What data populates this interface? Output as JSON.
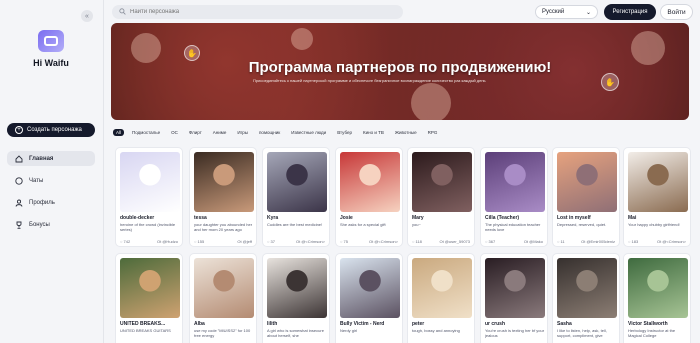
{
  "app": {
    "name": "Hi Waifu"
  },
  "search": {
    "placeholder": "Найти персонажа"
  },
  "language": {
    "selected": "Русский"
  },
  "header": {
    "register": "Регистрация",
    "login": "Войти"
  },
  "sidebar": {
    "create": "Создать персонажа",
    "items": [
      {
        "label": "Главная",
        "icon": "home-icon"
      },
      {
        "label": "Чаты",
        "icon": "chat-icon"
      },
      {
        "label": "Профиль",
        "icon": "user-icon"
      },
      {
        "label": "Бонусы",
        "icon": "trophy-icon"
      }
    ]
  },
  "banner": {
    "title": "Программа партнеров по продвижению!",
    "subtitle": "Присоединяйтесь к нашей партнерской программе и обеспечьте безграничное вознаграждение количество раз каждый день"
  },
  "tags": [
    "All",
    "Подмосталье",
    "OC",
    "Флирт",
    "Аниме",
    "Игры",
    "помощник",
    "Известные люди",
    "Втубер",
    "Кино и ТВ",
    "Животные",
    "RPG"
  ],
  "cards": [
    {
      "name": "double-decker",
      "desc": "heroine of the crowd (invincible series)",
      "count": "742",
      "author": "Ot @Hudzo",
      "colors": [
        "#d8d6f2",
        "#ffffff"
      ]
    },
    {
      "name": "tessa",
      "desc": "your daughter you abounded her and her mom 20 years ago",
      "count": "155",
      "author": "Ot @jeff",
      "colors": [
        "#3a2b22",
        "#c99a7a"
      ]
    },
    {
      "name": "Kyra",
      "desc": "Cuddles are the best medicine!",
      "count": "37",
      "author": "Ot @<Crimson>",
      "colors": [
        "#a5a7b8",
        "#3b3448"
      ]
    },
    {
      "name": "Josie",
      "desc": "She asks for a special gift",
      "count": "75",
      "author": "Ot @<Crimson>",
      "colors": [
        "#c73838",
        "#f6d2c0"
      ]
    },
    {
      "name": "Mary",
      "desc": "you~",
      "count": "118",
      "author": "Ot @user_59073",
      "colors": [
        "#2c1a1c",
        "#806060"
      ]
    },
    {
      "name": "Cilla (Teacher)",
      "desc": "The physical education teacher needs love",
      "count": "367",
      "author": "Ot @Mako",
      "colors": [
        "#5c3f79",
        "#a98cc6"
      ]
    },
    {
      "name": "Lost in myself",
      "desc": "Depressed, reserved, quiet.",
      "count": "11",
      "author": "Ot @Emir005deniz",
      "colors": [
        "#e6a27e",
        "#8f6f76"
      ]
    },
    {
      "name": "Mai",
      "desc": "Your happy chubby girlfriend!",
      "count": "183",
      "author": "Ot @<Crimson>",
      "colors": [
        "#f2ede8",
        "#8a6b50"
      ]
    },
    {
      "name": "UNITED BREAKS...",
      "desc": "UNITED BREAKS GUITARS",
      "count": "",
      "author": "",
      "colors": [
        "#4d6b3b",
        "#cfa271"
      ]
    },
    {
      "name": "Alba",
      "desc": "use my code \"MIUISS2\" for 100 free energy",
      "count": "",
      "author": "",
      "colors": [
        "#ece2d8",
        "#b48b72"
      ]
    },
    {
      "name": "lilith",
      "desc": "A girl who is somewhat insecure about herself, she",
      "count": "",
      "author": "",
      "colors": [
        "#e8e3de",
        "#3c3434"
      ]
    },
    {
      "name": "Bully Victim - Nerd",
      "desc": "Nerdy girl",
      "count": "",
      "author": "",
      "colors": [
        "#d9e3ee",
        "#5b5161"
      ]
    },
    {
      "name": "peter",
      "desc": "tough, bossy and annoying",
      "count": "",
      "author": "",
      "colors": [
        "#caa97f",
        "#f0e0c8"
      ]
    },
    {
      "name": "ur crush",
      "desc": "You're crush is texting her bf your jealous",
      "count": "",
      "author": "",
      "colors": [
        "#291d23",
        "#8a7a7c"
      ]
    },
    {
      "name": "Sasha",
      "desc": "I like to listen, help, ask, tell, support, compliment, give",
      "count": "",
      "author": "",
      "colors": [
        "#36302e",
        "#8c7e74"
      ]
    },
    {
      "name": "Victor Stallworth",
      "desc": "Herbology Instructor at the Magical College",
      "count": "",
      "author": "",
      "colors": [
        "#3f6b3f",
        "#a7c495"
      ]
    }
  ]
}
